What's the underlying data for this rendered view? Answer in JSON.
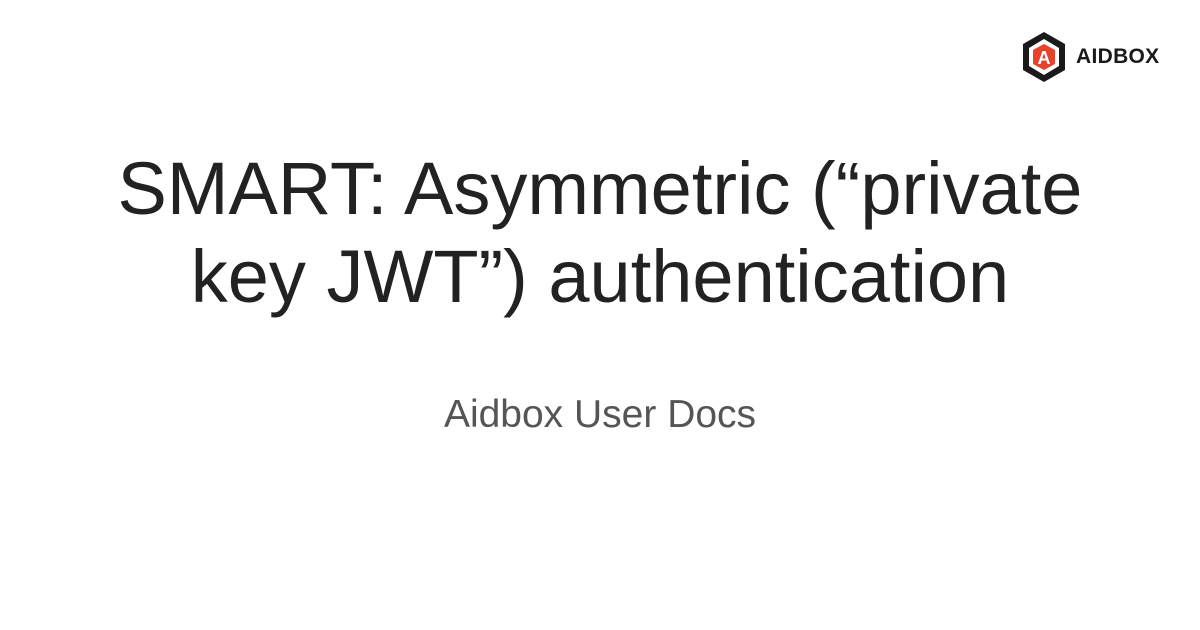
{
  "logo": {
    "icon": "aidbox-hexagon-logo-icon",
    "text": "AIDBOX",
    "mark_letter": "A",
    "accent_color": "#e8412c"
  },
  "title": "SMART: Asymmetric (“private key JWT”) authentication",
  "subtitle": "Aidbox User Docs"
}
